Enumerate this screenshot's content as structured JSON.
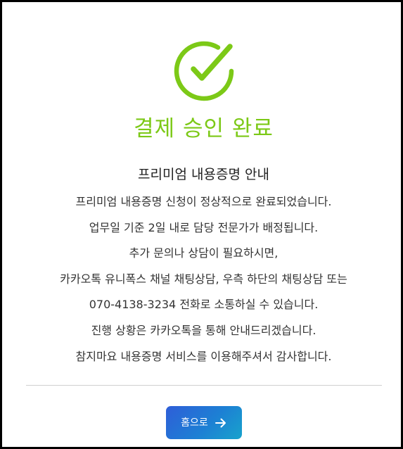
{
  "status": {
    "icon": "check-circle-icon",
    "title": "결제 승인 완료",
    "accent_color": "#7cc917"
  },
  "notice": {
    "subtitle": "프리미엄 내용증명 안내",
    "lines": [
      "프리미엄 내용증명 신청이 정상적으로 완료되었습니다.",
      "업무일 기준 2일 내로 담당 전문가가 배정됩니다.",
      "추가 문의나 상담이 필요하시면,",
      "카카오톡 유니폭스 채널 채팅상담, 우측 하단의 채팅상담 또는",
      "070-4138-3234 전화로 소통하실 수 있습니다.",
      "진행 상황은 카카오톡을 통해 안내드리겠습니다.",
      "참지마요 내용증명 서비스를 이용해주셔서 감사합니다."
    ]
  },
  "actions": {
    "home_label": "홈으로",
    "home_icon": "arrow-right-icon",
    "button_colors": [
      "#2f5ed8",
      "#18a3cc"
    ]
  }
}
